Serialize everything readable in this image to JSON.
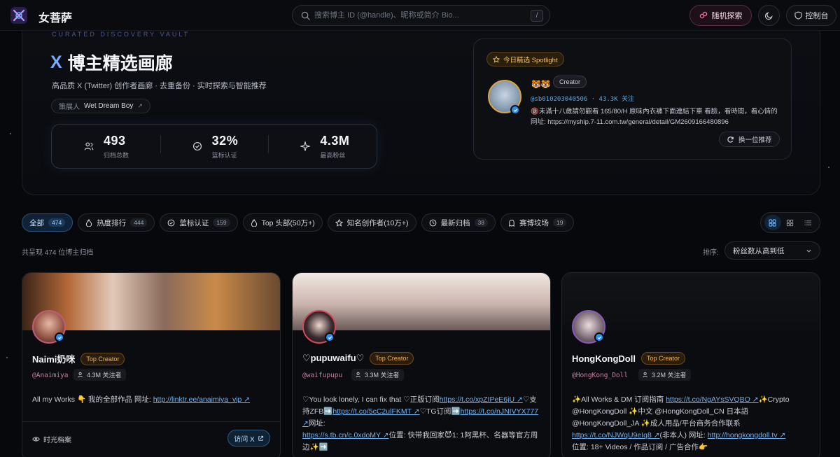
{
  "nav": {
    "brand": "女菩萨",
    "search_placeholder": "搜索博主 ID (@handle)、昵称或简介 Bio...",
    "search_shortcut": "/",
    "random_label": "随机探索",
    "console_label": "控制台"
  },
  "hero": {
    "kicker": "CURATED DISCOVERY VAULT",
    "title_x": "X",
    "title": "博主精选画廊",
    "subtitle": "高品质 X (Twitter) 创作者画廊 · 去重备份 · 实时探索与智能推荐",
    "curator_key": "策展人",
    "curator_name": "Wet Dream Boy",
    "stats": [
      {
        "value": "493",
        "label": "归档总数",
        "icon": "users-icon"
      },
      {
        "value": "32%",
        "label": "蓝标认证",
        "icon": "check-circle-icon"
      },
      {
        "value": "4.3M",
        "label": "最高粉丝",
        "icon": "sparkle-icon"
      }
    ]
  },
  "spotlight": {
    "badge": "今日精选 Spotlight",
    "emoji": "🐯🐯",
    "role": "Creator",
    "handle_line": "@sb010203040506 · 43.3K 关注",
    "bio": "🔞未滿十八歲請勿觀看 165/80/H 原味內衣褲下面連結下單 看臉，看時間，看心情的 网址: https://myship.7-11.com.tw/general/detail/GM2609166480896",
    "switch_label": "换一位推荐"
  },
  "filters": [
    {
      "label": "全部",
      "count": "474",
      "active": true,
      "icon": ""
    },
    {
      "label": "热度排行",
      "count": "444",
      "active": false,
      "icon": "flame-icon"
    },
    {
      "label": "蓝标认证",
      "count": "159",
      "active": false,
      "icon": "check-circle-icon"
    },
    {
      "label": "Top 头部(50万+)",
      "count": "",
      "active": false,
      "icon": "flame-icon"
    },
    {
      "label": "知名创作者(10万+)",
      "count": "",
      "active": false,
      "icon": "star-icon"
    },
    {
      "label": "最新归档",
      "count": "38",
      "active": false,
      "icon": "clock-icon"
    },
    {
      "label": "赛博坟场",
      "count": "19",
      "active": false,
      "icon": "ghost-icon"
    }
  ],
  "list": {
    "total_text": "共呈现 474 位博主归档",
    "sort_label": "排序:",
    "sort_value": "粉丝数从高到低"
  },
  "cards": [
    {
      "name": "Naimi奶咪",
      "badge": "Top Creator",
      "handle": "@Anaimiya",
      "fans": "4.3M 关注者",
      "bio_text": "All my Works 👇 我的全部作品 网址: ",
      "bio_link": "http://linktr.ee/anaimiya_vip ↗",
      "archive_label": "时光档案",
      "visit_label": "访问 X"
    },
    {
      "name": "♡pupuwaifu♡",
      "badge": "Top Creator",
      "handle": "@waifupupu",
      "fans": "3.3M 关注者",
      "bio_1": "♡You look lonely, I can fix that ♡正版订阅",
      "bio_link_1": "https://t.co/xpZIPeE6jU ↗",
      "bio_2": "♡支持ZFB➡️",
      "bio_link_2": "https://t.co/5cC2ulFKMT ↗",
      "bio_3": "♡TG订阅➡️",
      "bio_link_3": "https://t.co/nJNIVYX777 ↗",
      "bio_4": "网址:",
      "bio_link_4": "https://s.tb.cn/c.0xdoMY ↗",
      "bio_5": "位置: 快带我回家😈1: 1阿黑杯、名器等官方周边✨➡️"
    },
    {
      "name": "HongKongDoll",
      "badge": "Top Creator",
      "handle": "@HongKong_Doll",
      "fans": "3.2M 关注者",
      "bio_1": "✨All Works & DM 订阅指南 ",
      "bio_link_1": "https://t.co/NgAYsSVQBO ↗",
      "bio_2": "✨Crypto @HongKongDoll ✨中文 @HongKongDoll_CN 日本語 @HongKongDoll_JA ✨成人用品/平台商务合作联系 ",
      "bio_link_2": "https://t.co/NJWqU9eIq8 ↗",
      "bio_3": "(非本人) 网址: ",
      "bio_link_3": "http://hongkongdoll.tv ↗",
      "bio_4": "位置: 18+ Videos / 作品订阅 / 广告合作👉"
    }
  ]
}
